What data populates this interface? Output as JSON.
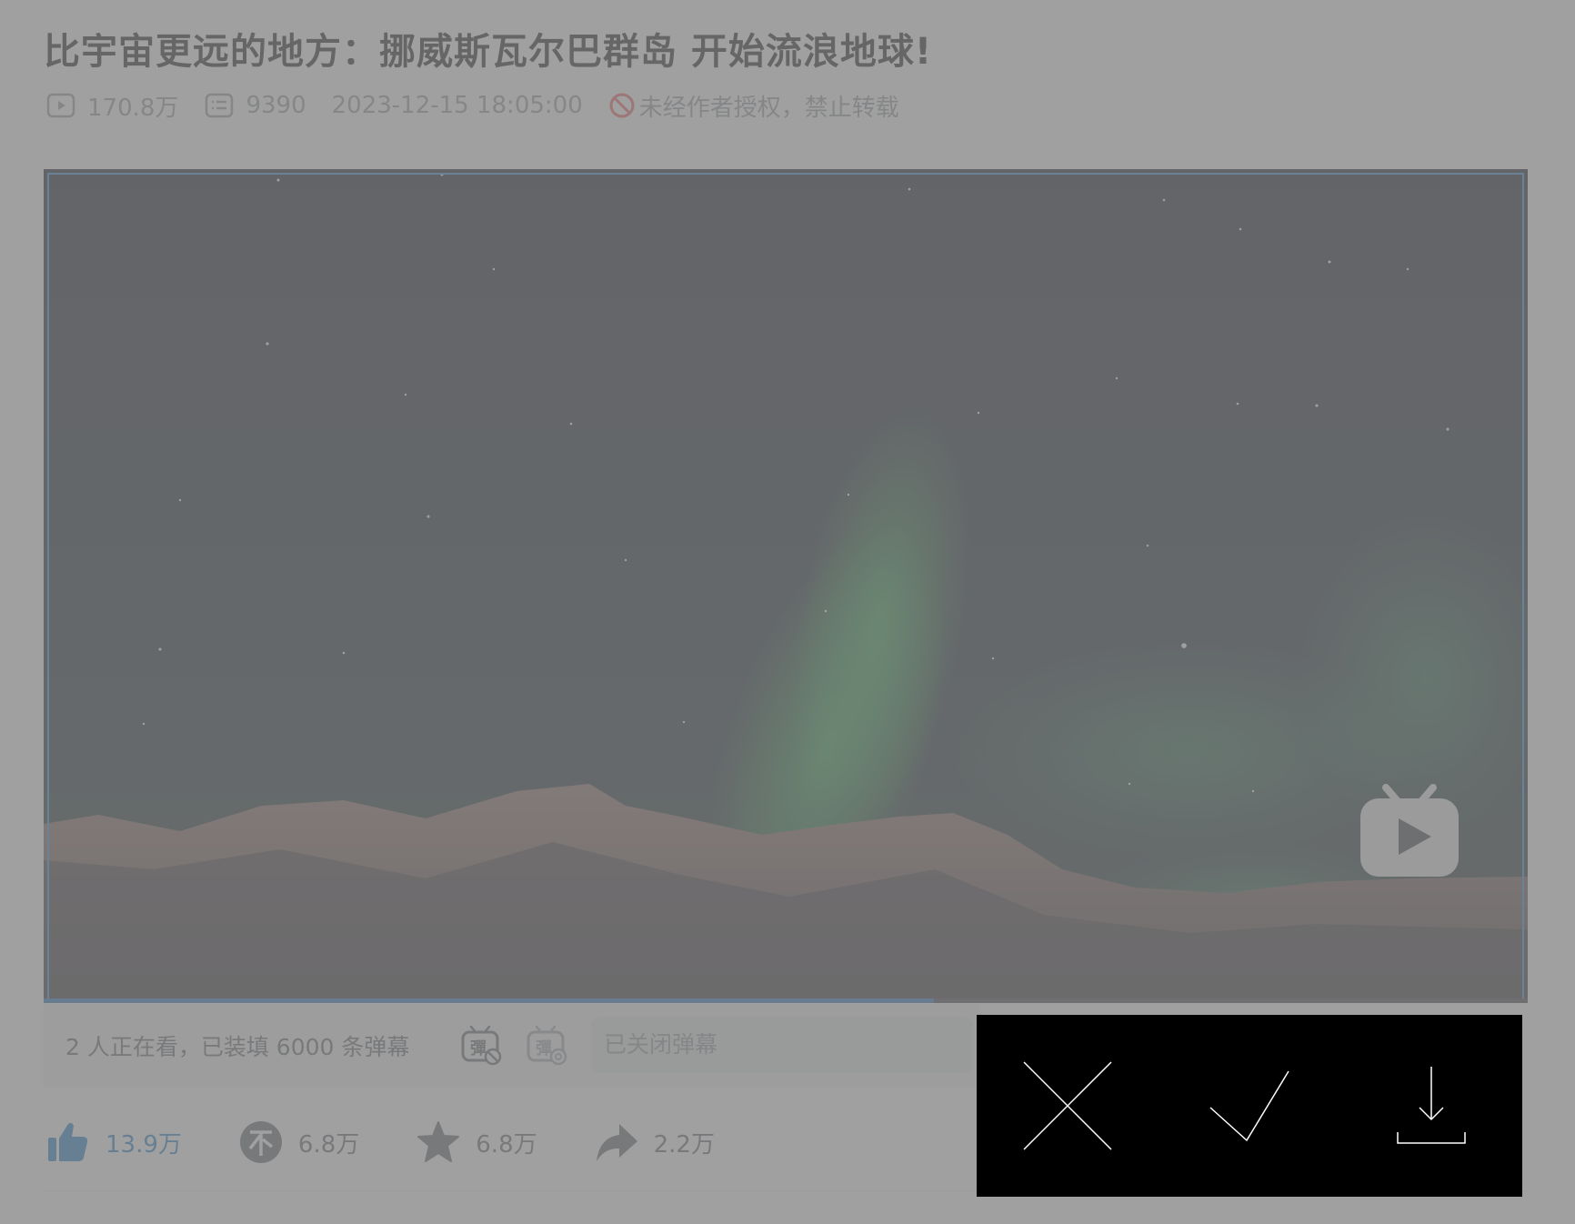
{
  "video": {
    "title": "比宇宙更远的地方：挪威斯瓦尔巴群岛 开始流浪地球!",
    "views": "170.8万",
    "danmaku_count": "9390",
    "publish_time": "2023-12-15 18:05:00",
    "copyright_notice": "未经作者授权，禁止转载"
  },
  "player": {
    "progress": 0.6,
    "frame_color": "#2f87d8",
    "logo_icon": "bilibili-tv-play-icon"
  },
  "danmaku_bar": {
    "watching_text": "2 人正在看，已装填 6000 条弹幕",
    "input_placeholder": "已关闭弹幕",
    "toggle_icon": "danmaku-off-icon",
    "settings_icon": "danmaku-settings-icon"
  },
  "actions": {
    "like": "13.9万",
    "coin": "6.8万",
    "favorite": "6.8万",
    "share": "2.2万",
    "accent_color": "#1f7ec8"
  },
  "edit_panel": {
    "icons": [
      "close-icon",
      "check-icon",
      "download-icon"
    ]
  }
}
